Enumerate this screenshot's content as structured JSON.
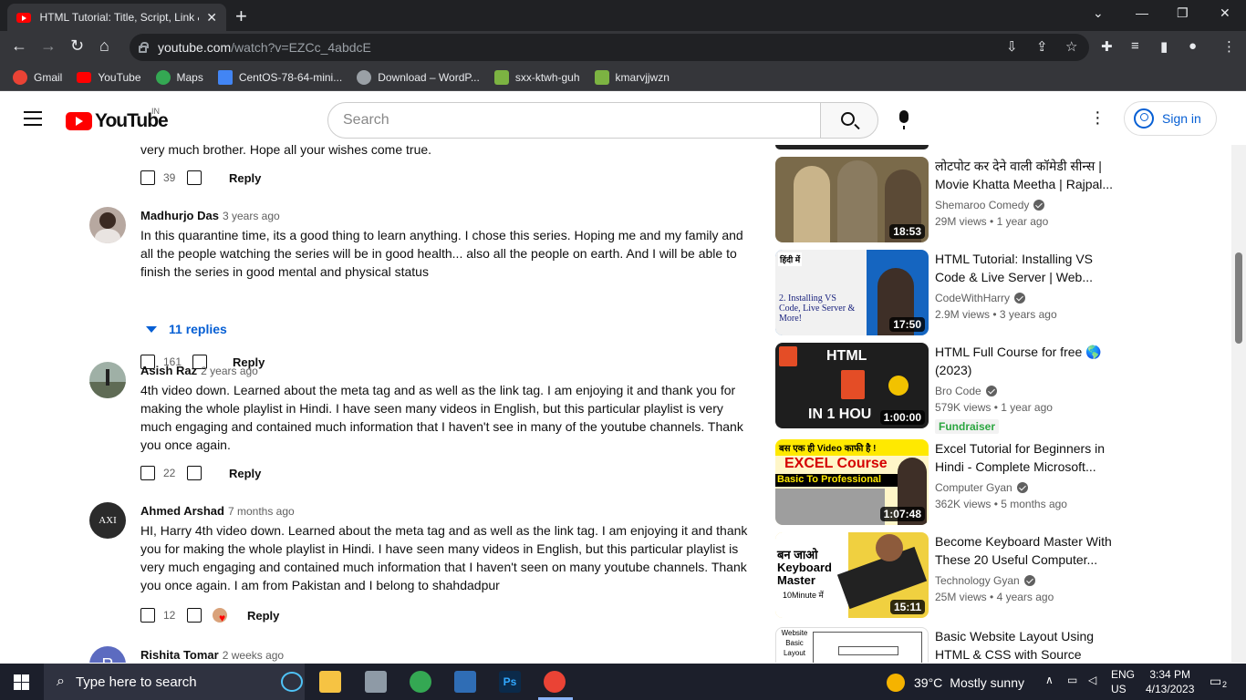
{
  "browser": {
    "tab_title": "HTML Tutorial: Title, Script, Link & Meta Tags",
    "tab_close": "✕",
    "new_tab": "+",
    "url_host": "youtube.com",
    "url_path": "/watch?v=EZCc_4abdcE",
    "bookmarks": [
      {
        "label": "Gmail",
        "color": "#ea4335"
      },
      {
        "label": "YouTube",
        "color": "#ff0000"
      },
      {
        "label": "Maps",
        "color": "#34a853"
      },
      {
        "label": "CentOS-78-64-mini...",
        "color": "#4285f4"
      },
      {
        "label": "Download – WordP...",
        "color": "#9aa0a6"
      },
      {
        "label": "sxx-ktwh-guh",
        "color": "#7cb342"
      },
      {
        "label": "kmarvjjwzn",
        "color": "#7cb342"
      }
    ]
  },
  "youtube": {
    "logo_text": "YouTube",
    "country": "IN",
    "search_placeholder": "Search",
    "sign_in": "Sign in"
  },
  "comments": {
    "prev_tail": "very much brother. Hope all your wishes come true.",
    "prev_likes": "39",
    "reply_label": "Reply",
    "items": [
      {
        "author": "Madhurjo Das",
        "time": "3 years ago",
        "text": "In this quarantine time, its a good thing to learn anything. I chose this series. Hoping me and my family and all the people watching the series will be in good health... also all the people on earth. And I will be able to finish the series in good mental and physical status",
        "likes": "161",
        "replies": "11 replies"
      },
      {
        "author": "Asish Raz",
        "time": "2 years ago",
        "text": "4th video down. Learned about the meta tag and as well as the link tag. I am enjoying it and thank you for making the whole playlist in Hindi. I have seen many videos in English, but this particular playlist is very much engaging and contained much information that I haven't see in many of the youtube channels. Thank you once again.",
        "likes": "22"
      },
      {
        "author": "Ahmed Arshad",
        "time": "7 months ago",
        "avatar_text": "AXI",
        "text": "HI, Harry 4th video down. Learned about the meta tag and as well as the link tag. I am enjoying it and thank you for making the whole playlist in Hindi. I have seen many videos in English, but this particular playlist is very much engaging and contained much information that I haven't seen on many youtube channels. Thank you once again. I am from Pakistan and I belong to shahdadpur",
        "likes": "12"
      },
      {
        "author": "Rishita Tomar",
        "time": "2 weeks ago",
        "avatar_text": "R"
      }
    ]
  },
  "sidebar": {
    "videos": [
      {
        "title": "लोटपोट कर देने वाली कॉमेडी सीन्स | Movie Khatta Meetha | Rajpal...",
        "channel": "Shemaroo Comedy",
        "views": "29M views",
        "age": "1 year ago",
        "duration": "18:53",
        "thumb_color": "#7a6a4a"
      },
      {
        "title": "HTML Tutorial: Installing VS Code & Live Server | Web...",
        "channel": "CodeWithHarry",
        "views": "2.9M views",
        "age": "3 years ago",
        "duration": "17:50",
        "thumb_color": "#1565c0",
        "thumb_text": "2. Installing VS Code, Live Server & More!",
        "thumb_tag": "हिंदी में"
      },
      {
        "title": "HTML Full Course for free 🌎 (2023)",
        "channel": "Bro Code",
        "views": "579K views",
        "age": "1 year ago",
        "duration": "1:00:00",
        "badge": "Fundraiser",
        "thumb_color": "#1e1e1e",
        "thumb_text": "HTML",
        "thumb_sub": "IN 1 HOU"
      },
      {
        "title": "Excel Tutorial for Beginners in Hindi - Complete Microsoft...",
        "channel": "Computer Gyan",
        "views": "362K views",
        "age": "5 months ago",
        "duration": "1:07:48",
        "thumb_color": "#fff6c8",
        "thumb_text": "EXCEL Course",
        "thumb_top": "बस एक ही Video काफी है !",
        "thumb_sub": "Basic To Professional"
      },
      {
        "title": "Become Keyboard Master With These 20 Useful Computer...",
        "channel": "Technology Gyan",
        "views": "25M views",
        "age": "4 years ago",
        "duration": "15:11",
        "thumb_color": "#f0d040",
        "thumb_text": "बन जाओ Keyboard Master",
        "thumb_sub": "10Minute में"
      },
      {
        "title": "Basic Website Layout Using HTML & CSS with Source Cod...",
        "thumb_color": "#ffffff",
        "thumb_text": "Website Basic Layout"
      }
    ]
  },
  "taskbar": {
    "search_placeholder": "Type here to search",
    "weather_temp": "39°C",
    "weather_desc": "Mostly sunny",
    "lang": "ENG",
    "region": "US",
    "time": "3:34 PM",
    "date": "4/13/2023",
    "notif_count": "2"
  }
}
